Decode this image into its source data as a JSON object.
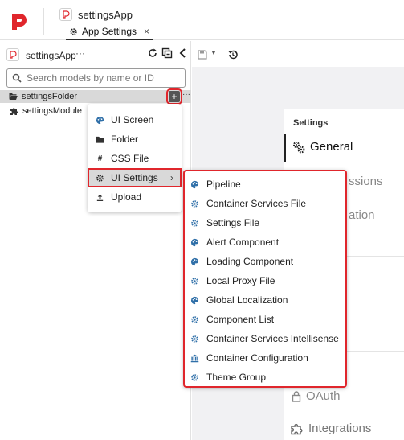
{
  "header": {
    "app_name": "settingsApp",
    "active_tab": "App Settings"
  },
  "sidebar": {
    "app_name": "settingsApp",
    "dots": "···",
    "search_placeholder": "Search models by name or ID",
    "tree": [
      {
        "label": "settingsFolder",
        "type": "folder"
      },
      {
        "label": "settingsModule",
        "type": "module"
      }
    ]
  },
  "add_menu": {
    "items": [
      {
        "label": "UI Screen",
        "icon": "palette-icon"
      },
      {
        "label": "Folder",
        "icon": "folder-icon"
      },
      {
        "label": "CSS File",
        "icon": "hash-icon"
      },
      {
        "label": "UI Settings",
        "icon": "gear-icon",
        "has_submenu": true,
        "highlighted": true
      },
      {
        "label": "Upload",
        "icon": "upload-icon"
      }
    ]
  },
  "ui_settings_submenu": {
    "items": [
      {
        "label": "Pipeline",
        "icon": "palette-icon"
      },
      {
        "label": "Container Services File",
        "icon": "cog-icon"
      },
      {
        "label": "Settings File",
        "icon": "cog-icon"
      },
      {
        "label": "Alert Component",
        "icon": "palette-icon"
      },
      {
        "label": "Loading Component",
        "icon": "palette-icon"
      },
      {
        "label": "Local Proxy File",
        "icon": "cog-icon"
      },
      {
        "label": "Global Localization",
        "icon": "palette-icon"
      },
      {
        "label": "Component List",
        "icon": "cog-icon"
      },
      {
        "label": "Container Services Intellisense",
        "icon": "cog-icon"
      },
      {
        "label": "Container Configuration",
        "icon": "bank-icon"
      },
      {
        "label": "Theme Group",
        "icon": "cog-icon"
      }
    ]
  },
  "settings_panel": {
    "heading": "Settings",
    "nav": [
      {
        "label": "General",
        "active": true
      },
      {
        "label": "Integrations",
        "active": false
      }
    ],
    "partial_labels": [
      "ssions",
      "ation",
      "OAuth"
    ]
  },
  "colors": {
    "highlight_outline": "#e0262c",
    "icon_blue": "#2f6fa8",
    "logo_red": "#e0262c",
    "selected_row": "#d9d9d9"
  }
}
